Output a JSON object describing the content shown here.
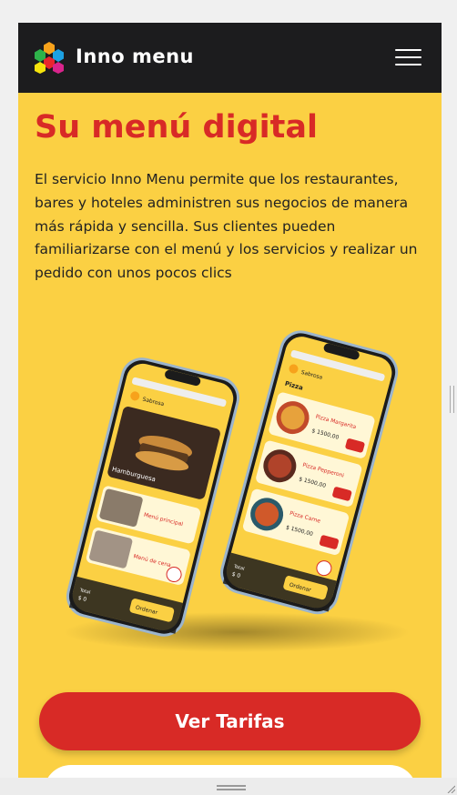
{
  "header": {
    "brand": "Inno menu"
  },
  "hero": {
    "title": "Su menú digital",
    "description": "El servicio Inno Menu permite que los restaurantes, bares y hoteles administren sus negocios de manera más rápida y sencilla. Sus clientes pueden familiarizarse con el menú y los servicios y realizar un pedido con unos pocos clics"
  },
  "phone_left": {
    "restaurant": "Sabrosa",
    "hero_item": "Hamburguesa",
    "items": [
      "Menú principal",
      "Menú de cena"
    ],
    "total_label": "Total",
    "total_value": "$ 0",
    "order_button": "Ordenar"
  },
  "phone_right": {
    "restaurant": "Sabrosa",
    "section": "Pizza",
    "items": [
      {
        "name": "Pizza Margarita",
        "price": "$ 1500,00"
      },
      {
        "name": "Pizza Pepperoni",
        "price": "$ 1500,00"
      },
      {
        "name": "Pizza Carne",
        "price": "$ 1500,00"
      }
    ],
    "total_label": "Total",
    "total_value": "$ 0",
    "order_button": "Ordenar"
  },
  "cta": {
    "primary_label": "Ver Tarifas"
  },
  "colors": {
    "accent": "#d82a26",
    "background": "#fbd043",
    "navbar": "#1c1c1e"
  }
}
